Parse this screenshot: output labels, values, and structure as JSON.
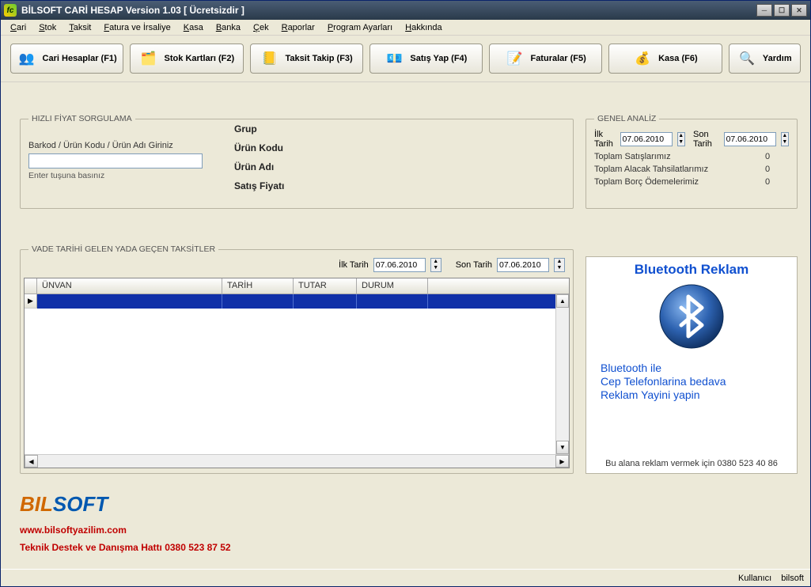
{
  "window": {
    "title": "BİLSOFT CARİ HESAP Version 1.03   [ Ücretsizdir ]"
  },
  "menu": {
    "items": [
      {
        "label": "Cari",
        "u": "C"
      },
      {
        "label": "Stok",
        "u": "S"
      },
      {
        "label": "Taksit",
        "u": "T"
      },
      {
        "label": "Fatura ve İrsaliye",
        "u": "F"
      },
      {
        "label": "Kasa",
        "u": "K"
      },
      {
        "label": "Banka",
        "u": "B"
      },
      {
        "label": "Çek",
        "u": "Ç"
      },
      {
        "label": "Raporlar",
        "u": "R"
      },
      {
        "label": "Program Ayarları",
        "u": "P"
      },
      {
        "label": "Hakkında",
        "u": "H"
      }
    ]
  },
  "toolbar": {
    "b1": "Cari Hesaplar (F1)",
    "b2": "Stok Kartları (F2)",
    "b3": "Taksit Takip (F3)",
    "b4": "Satış Yap (F4)",
    "b5": "Faturalar (F5)",
    "b6": "Kasa (F6)",
    "b7": "Yardım"
  },
  "hizli": {
    "legend": "HIZLI FİYAT SORGULAMA",
    "lbl_barkod": "Barkod / Ürün Kodu / Ürün Adı Giriniz",
    "lbl_enter": "Enter tuşuna basınız",
    "l_grup": "Grup",
    "l_kod": "Ürün Kodu",
    "l_adi": "Ürün Adı",
    "l_fiyat": "Satış Fiyatı"
  },
  "genel": {
    "legend": "GENEL ANALİZ",
    "lbl_ilk": "İlk Tarih",
    "lbl_son": "Son Tarih",
    "ilk_val": "07.06.2010",
    "son_val": "07.06.2010",
    "s1_label": "Toplam Satışlarımız",
    "s1_val": "0",
    "s2_label": "Toplam Alacak Tahsilatlarımız",
    "s2_val": "0",
    "s3_label": "Toplam Borç Ödemelerimiz",
    "s3_val": "0"
  },
  "taksit": {
    "legend": "VADE TARİHİ GELEN YADA GEÇEN TAKSİTLER",
    "lbl_ilk": "İlk Tarih",
    "lbl_son": "Son Tarih",
    "ilk_val": "07.06.2010",
    "son_val": "07.06.2010",
    "cols": {
      "unvan": "ÜNVAN",
      "tarih": "TARİH",
      "tutar": "TUTAR",
      "durum": "DURUM"
    }
  },
  "ad": {
    "title": "Bluetooth Reklam",
    "line1": "Bluetooth ile",
    "line2": "Cep Telefonlarina bedava",
    "line3": "Reklam Yayini yapin",
    "footer": "Bu alana reklam vermek için 0380 523 40 86"
  },
  "footer": {
    "logo_b": "BIL",
    "logo_s": "SOFT",
    "url": "www.bilsoftyazilim.com",
    "support": "Teknik Destek ve Danışma Hattı 0380 523 87 52"
  },
  "status": {
    "user_label": "Kullanıcı",
    "user_val": "bilsoft"
  }
}
